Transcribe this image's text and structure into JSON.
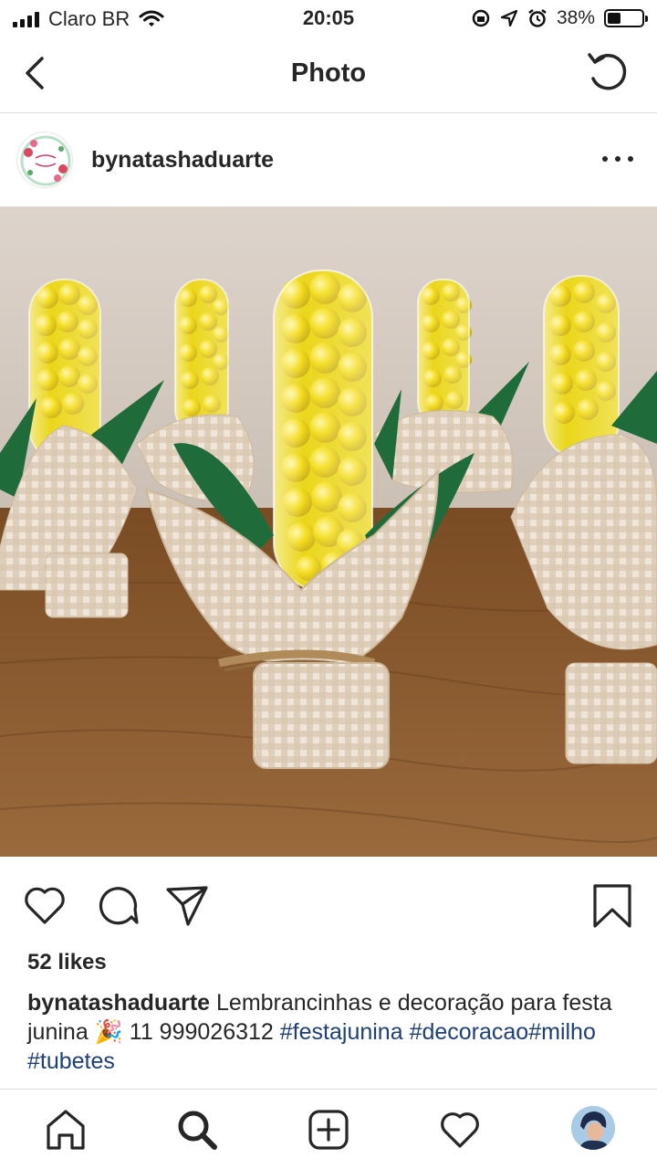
{
  "status_bar": {
    "carrier": "Claro BR",
    "time": "20:05",
    "battery": "38%",
    "battery_level": 0.38
  },
  "nav": {
    "title": "Photo",
    "back_icon": "chevron-left-icon",
    "refresh_icon": "refresh-icon"
  },
  "post": {
    "username": "bynatashaduarte",
    "avatar_icon": "floral-logo-icon",
    "more_icon": "more-horizontal-icon",
    "likes": "52 likes",
    "caption": {
      "username": "bynatashaduarte",
      "text": "Lembrancinhas e decoração para festa junina",
      "emoji": "🎉",
      "phone": "11 999026312",
      "hashtags": [
        "#festajunina",
        "#decoracao",
        "#milho",
        "#tubetes"
      ]
    }
  },
  "actions": {
    "like_icon": "heart-icon",
    "comment_icon": "comment-icon",
    "share_icon": "send-icon",
    "save_icon": "bookmark-icon"
  },
  "tabbar": {
    "items": [
      "home-icon",
      "search-icon",
      "new-post-icon",
      "activity-heart-icon",
      "profile-avatar"
    ]
  },
  "colors": {
    "hashtag": "#1f3f77",
    "text": "#262626",
    "divider": "#dbdbdb",
    "corn_yellow": "#f0d000",
    "leaf_green": "#1f6b3a",
    "wood": "#8a5a2e"
  }
}
